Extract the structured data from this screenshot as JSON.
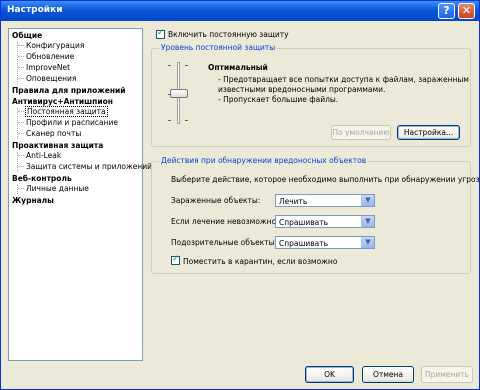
{
  "window": {
    "title": "Настройки",
    "help_glyph": "?",
    "close_glyph": "✕"
  },
  "tree": {
    "general": "Общие",
    "general_items": [
      "Конфигурация",
      "Обновление",
      "ImproveNet",
      "Оповещения"
    ],
    "app_rules": "Правила для приложений",
    "antivirus": "Антивирус+Антишпион",
    "antivirus_items": [
      "Постоянная защита",
      "Профили и расписание",
      "Сканер почты"
    ],
    "proactive": "Проактивная защита",
    "proactive_items": [
      "Anti-Leak",
      "Защита системы и приложений"
    ],
    "web": "Веб-контроль",
    "web_items": [
      "Личные данные"
    ],
    "logs": "Журналы"
  },
  "protection": {
    "enable_label": "Включить постоянную защиту",
    "level_group_title": "Уровень постоянной защиты",
    "level_name": "Оптимальный",
    "level_desc_line1": "- Предотвращает все попытки доступа к файлам, зараженным",
    "level_desc_line2": "известными вредоносными программами.",
    "level_desc_line3": "- Пропускает большие файлы.",
    "default_button": "По умолчанию",
    "settings_button": "Настройка...",
    "slider_level": 0.5
  },
  "actions": {
    "group_title": "Действия при обнаружении вредоносных объектов",
    "instruction": "Выберите действие, которое необходимо выполнить при обнаружении угрозы.",
    "infected_label": "Зараженные объекты:",
    "infected_value": "Лечить",
    "cure_fail_label": "Если лечение невозможно:",
    "cure_fail_value": "Спрашивать",
    "suspicious_label": "Подозрительные объекты:",
    "suspicious_value": "Спрашивать",
    "quarantine_label": "Поместить в карантин, если возможно",
    "dropdown_glyph": "▼"
  },
  "footer": {
    "ok": "OK",
    "cancel": "Отмена",
    "apply": "Применить"
  }
}
